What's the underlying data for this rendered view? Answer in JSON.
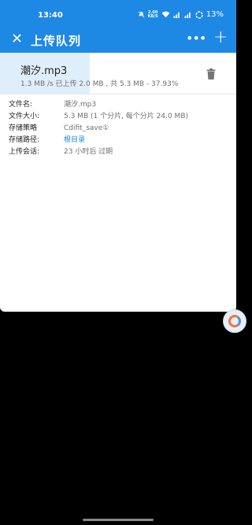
{
  "status_bar": {
    "time": "13:40",
    "net_speed_top": "2.00",
    "net_speed_unit": "KB/S",
    "battery": "13%"
  },
  "app_bar": {
    "title": "上传队列",
    "close_icon": "close-icon",
    "more_icon": "more-icon",
    "add_icon": "add-icon"
  },
  "upload": {
    "file_name": "潮汐.mp3",
    "stats": "1.3 MB /s 已上传 2.0 MB , 共 5.3 MB - 37.93%",
    "progress": 0.3793,
    "accent_color": "#dfeefb"
  },
  "details": [
    {
      "label": "文件名:",
      "value": "潮汐.mp3",
      "link": false
    },
    {
      "label": "文件大小:",
      "value": "5.3 MB (1 个分片, 每个分片 24.0 MB)",
      "link": false
    },
    {
      "label": "存储策略",
      "value": "Cdifit_save①",
      "link": false
    },
    {
      "label": "存储路径:",
      "value": "根目录",
      "link": true
    },
    {
      "label": "上传会话:",
      "value": "23 小时后 过期",
      "link": false
    }
  ],
  "colors": {
    "primary": "#1e88e5",
    "background": "#000000"
  }
}
